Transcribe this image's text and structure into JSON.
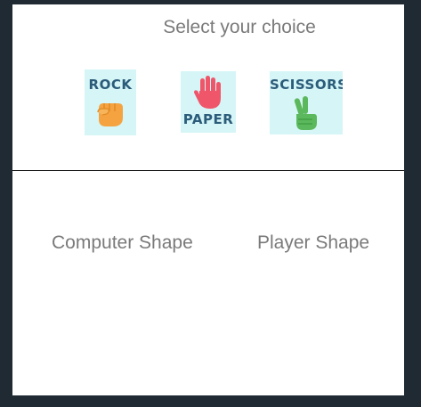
{
  "header": {
    "title": "Select your choice"
  },
  "choices": [
    {
      "id": "rock",
      "label": "ROCK",
      "icon": "fist-icon",
      "hand_color": "#f5a340"
    },
    {
      "id": "paper",
      "label": "PAPER",
      "icon": "open-hand-icon",
      "hand_color": "#f0566a"
    },
    {
      "id": "scissors",
      "label": "SCISSORS",
      "icon": "peace-hand-icon",
      "hand_color": "#5cb85c"
    }
  ],
  "results": {
    "computer_label": "Computer Shape",
    "player_label": "Player Shape"
  },
  "colors": {
    "background": "#1f2a33",
    "card": "#d5f5f7",
    "label_text": "#2b5c7a",
    "muted_text": "#7a7a7a"
  }
}
